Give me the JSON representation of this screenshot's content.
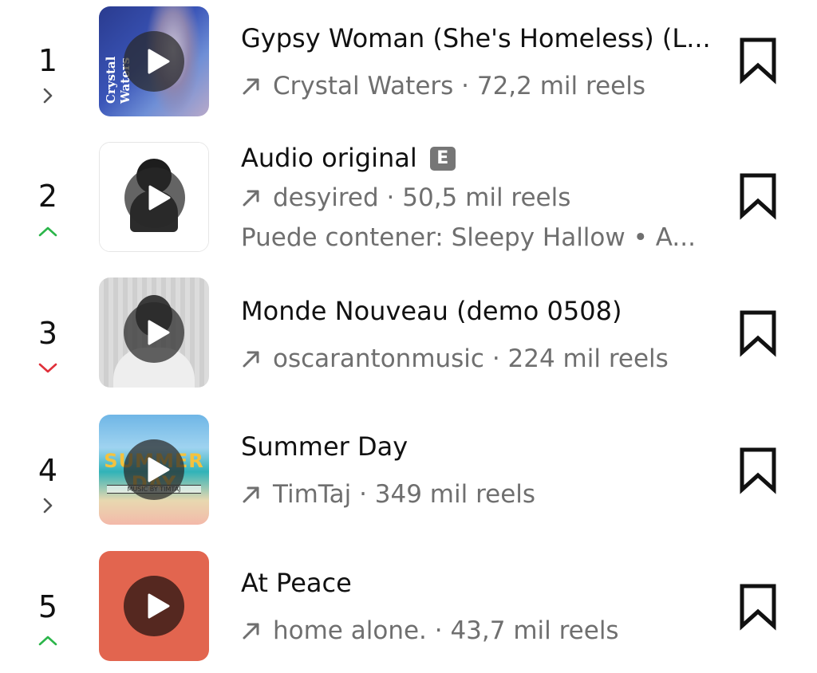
{
  "tracks": [
    {
      "rank": "1",
      "trend": "same",
      "title": "Gypsy Woman (She's Homeless) (L...",
      "artist": "Crystal Waters",
      "separator": " · ",
      "reels": "72,2 mil reels",
      "cover_text": "Crystal Waters"
    },
    {
      "rank": "2",
      "trend": "up",
      "title": "Audio original",
      "explicit_badge": "E",
      "artist": "desyired",
      "separator": " · ",
      "reels": "50,5 mil reels",
      "contains": "Puede contener: Sleepy Hallow • A..."
    },
    {
      "rank": "3",
      "trend": "down",
      "title": "Monde Nouveau (demo 0508)",
      "artist": "oscarantonmusic",
      "separator": " · ",
      "reels": "224 mil reels"
    },
    {
      "rank": "4",
      "trend": "same",
      "title": "Summer Day",
      "artist": "TimTaj",
      "separator": " · ",
      "reels": "349 mil reels",
      "cover_text": "SUMMER DAY",
      "cover_subtext": "MUSIC BY TIMTAJ"
    },
    {
      "rank": "5",
      "trend": "up",
      "title": "At Peace",
      "artist": "home alone.",
      "separator": " · ",
      "reels": "43,7 mil reels"
    }
  ],
  "colors": {
    "trend_up": "#2bb54a",
    "trend_down": "#e0303a",
    "trend_same": "#555555",
    "meta_text": "#6f6f6f",
    "cover5": "#e2654f"
  },
  "icons": {
    "trend_up": "chevron-up-icon",
    "trend_down": "chevron-down-icon",
    "trend_same": "chevron-right-icon",
    "play": "play-icon",
    "save": "bookmark-icon",
    "artist_link": "arrow-up-right-icon"
  }
}
